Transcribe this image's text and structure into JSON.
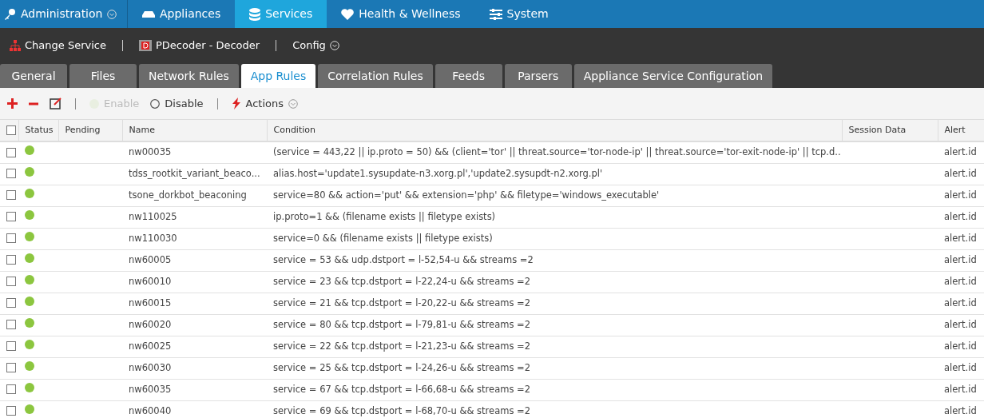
{
  "top_nav": [
    {
      "label": "Administration",
      "selected": false
    },
    {
      "label": "Appliances",
      "selected": false
    },
    {
      "label": "Services",
      "selected": true
    },
    {
      "label": "Health & Wellness",
      "selected": false
    },
    {
      "label": "System",
      "selected": false
    }
  ],
  "service_bar": [
    {
      "label": "Change Service"
    },
    {
      "label": "PDecoder - Decoder"
    },
    {
      "label": "Config"
    }
  ],
  "tabs": [
    {
      "label": "General",
      "selected": false
    },
    {
      "label": "Files",
      "selected": false
    },
    {
      "label": "Network Rules",
      "selected": false
    },
    {
      "label": "App Rules",
      "selected": true
    },
    {
      "label": "Correlation Rules",
      "selected": false
    },
    {
      "label": "Feeds",
      "selected": false
    },
    {
      "label": "Parsers",
      "selected": false
    },
    {
      "label": "Appliance Service Configuration",
      "selected": false
    }
  ],
  "toolbar": [
    {
      "kind": "icon"
    },
    {
      "kind": "icon"
    },
    {
      "kind": "icon"
    },
    {
      "kind": "separator"
    },
    {
      "kind": "status",
      "label": "Enable",
      "disabled": true
    },
    {
      "kind": "status",
      "label": "Disable",
      "disabled": false
    },
    {
      "kind": "separator"
    },
    {
      "kind": "menu",
      "label": "Actions",
      "disabled": false
    }
  ],
  "table": {
    "columns": [
      "Status",
      "Pending",
      "Name",
      "Condition",
      "Session Data",
      "Alert"
    ],
    "all_checked": false,
    "rows": [
      {
        "checked": false,
        "enabled": true,
        "name": "nw00035",
        "condition": "(service = 443,22 || ip.proto = 50) && (client='tor' || threat.source='tor-node-ip' || threat.source='tor-exit-node-ip' || tcp.d...",
        "alert": "alert.id"
      },
      {
        "checked": false,
        "enabled": true,
        "name": "tdss_rootkit_variant_beaco...",
        "condition": "alias.host='update1.sysupdate-n3.xorg.pl','update2.sysupdt-n2.xorg.pl'",
        "alert": "alert.id"
      },
      {
        "checked": false,
        "enabled": true,
        "name": "tsone_dorkbot_beaconing",
        "condition": "service=80 && action='put' && extension='php' && filetype='windows_executable'",
        "alert": "alert.id"
      },
      {
        "checked": false,
        "enabled": true,
        "name": "nw110025",
        "condition": "ip.proto=1 && (filename exists || filetype exists)",
        "alert": "alert.id"
      },
      {
        "checked": false,
        "enabled": true,
        "name": "nw110030",
        "condition": "service=0 && (filename exists || filetype exists)",
        "alert": "alert.id"
      },
      {
        "checked": false,
        "enabled": true,
        "name": "nw60005",
        "condition": "service = 53 && udp.dstport = l-52,54-u && streams =2",
        "alert": "alert.id"
      },
      {
        "checked": false,
        "enabled": true,
        "name": "nw60010",
        "condition": "service = 23 && tcp.dstport = l-22,24-u && streams =2",
        "alert": "alert.id"
      },
      {
        "checked": false,
        "enabled": true,
        "name": "nw60015",
        "condition": "service = 21 && tcp.dstport = l-20,22-u && streams =2",
        "alert": "alert.id"
      },
      {
        "checked": false,
        "enabled": true,
        "name": "nw60020",
        "condition": "service = 80 && tcp.dstport = l-79,81-u && streams =2",
        "alert": "alert.id"
      },
      {
        "checked": false,
        "enabled": true,
        "name": "nw60025",
        "condition": "service = 22 && tcp.dstport = l-21,23-u && streams =2",
        "alert": "alert.id"
      },
      {
        "checked": false,
        "enabled": true,
        "name": "nw60030",
        "condition": "service = 25 && tcp.dstport = l-24,26-u && streams =2",
        "alert": "alert.id"
      },
      {
        "checked": false,
        "enabled": true,
        "name": "nw60035",
        "condition": "service = 67 && tcp.dstport = l-66,68-u && streams =2",
        "alert": "alert.id"
      },
      {
        "checked": false,
        "enabled": true,
        "name": "nw60040",
        "condition": "service = 69 && tcp.dstport = l-68,70-u && streams =2",
        "alert": "alert.id"
      }
    ]
  }
}
